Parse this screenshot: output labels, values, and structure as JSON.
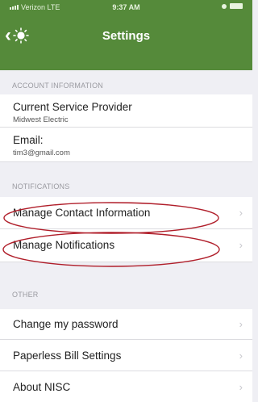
{
  "status_bar": {
    "carrier": "Verizon",
    "network": "LTE",
    "time": "9:37 AM"
  },
  "nav": {
    "title": "Settings",
    "back_icon": "chevron-left-icon",
    "logo_icon": "sun-logo-icon"
  },
  "account": {
    "header": "ACCOUNT INFORMATION",
    "provider_label": "Current Service Provider",
    "provider_value": "Midwest Electric",
    "email_label": "Email:",
    "email_value": "tim3@gmail.com"
  },
  "notifications": {
    "header": "NOTIFICATIONS",
    "items": [
      {
        "label": "Manage Contact Information"
      },
      {
        "label": "Manage Notifications"
      }
    ]
  },
  "other": {
    "header": "OTHER",
    "items": [
      {
        "label": "Change my password"
      },
      {
        "label": "Paperless Bill Settings"
      },
      {
        "label": "About NISC"
      }
    ]
  },
  "colors": {
    "header_green": "#558a3a",
    "annotation_red": "#b01e2a",
    "background": "#efeff4"
  }
}
